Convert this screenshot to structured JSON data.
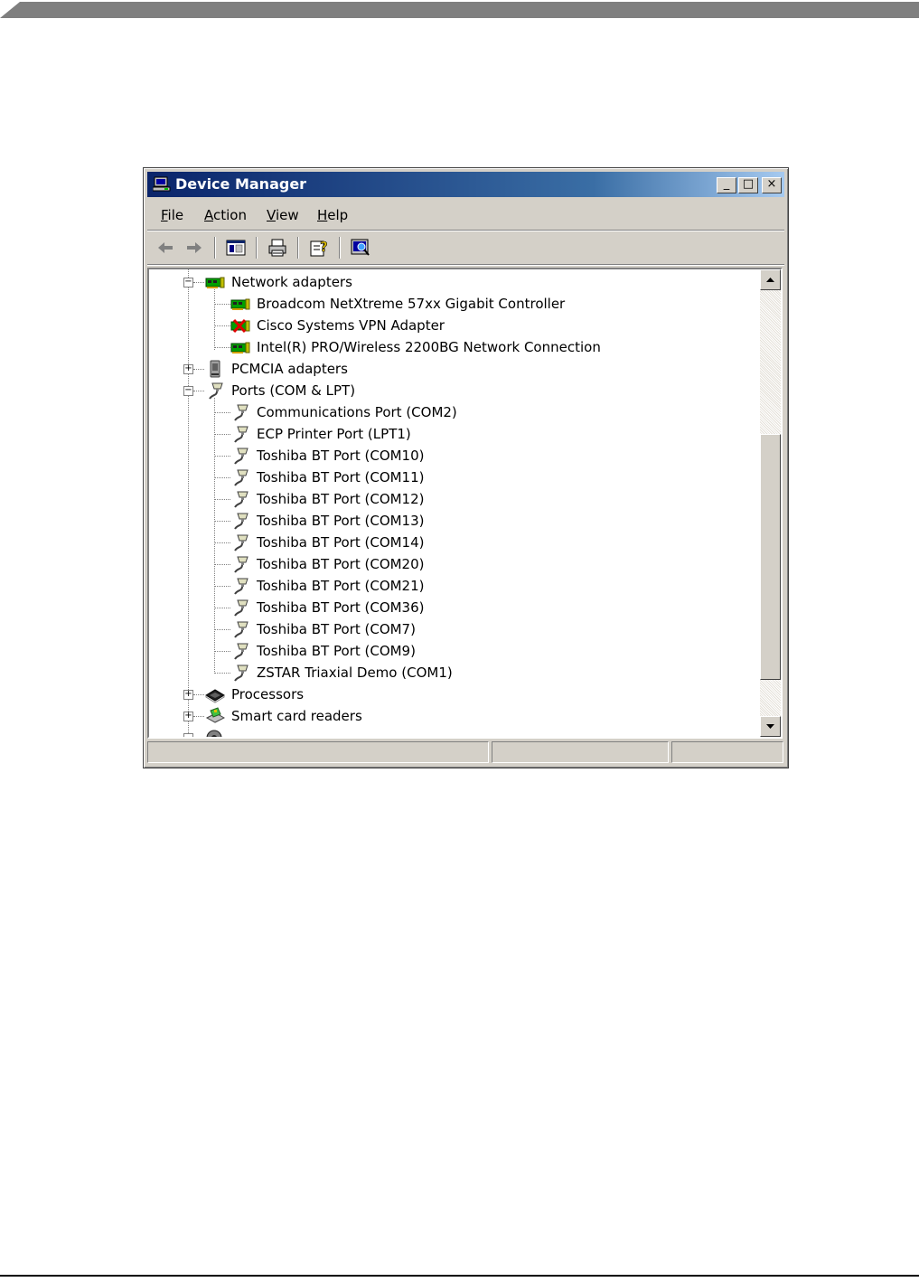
{
  "window": {
    "title": "Device Manager",
    "controls": {
      "minimize": "_",
      "maximize": "□",
      "close": "×"
    }
  },
  "menu": [
    {
      "accel": "F",
      "rest": "ile"
    },
    {
      "accel": "A",
      "rest": "ction"
    },
    {
      "accel": "V",
      "rest": "iew"
    },
    {
      "accel": "H",
      "rest": "elp"
    }
  ],
  "toolbar_icons": [
    "back-arrow-icon",
    "forward-arrow-icon",
    "show-hide-console-tree-icon",
    "print-icon",
    "help-properties-icon",
    "scan-hardware-icon"
  ],
  "tree": {
    "network_adapters": {
      "label": "Network adapters",
      "expander": "−",
      "children": [
        "Broadcom NetXtreme 57xx Gigabit Controller",
        "Cisco Systems VPN Adapter",
        "Intel(R) PRO/Wireless 2200BG Network Connection"
      ]
    },
    "pcmcia": {
      "label": "PCMCIA adapters",
      "expander": "+"
    },
    "ports": {
      "label": "Ports (COM & LPT)",
      "expander": "−",
      "children": [
        "Communications Port (COM2)",
        "ECP Printer Port (LPT1)",
        "Toshiba BT Port (COM10)",
        "Toshiba BT Port (COM11)",
        "Toshiba BT Port (COM12)",
        "Toshiba BT Port (COM13)",
        "Toshiba BT Port (COM14)",
        "Toshiba BT Port (COM20)",
        "Toshiba BT Port (COM21)",
        "Toshiba BT Port (COM36)",
        "Toshiba BT Port (COM7)",
        "Toshiba BT Port (COM9)",
        "ZSTAR Triaxial Demo (COM1)"
      ]
    },
    "processors": {
      "label": "Processors",
      "expander": "+"
    },
    "smart_card_readers": {
      "label": "Smart card readers",
      "expander": "+"
    }
  },
  "colors": {
    "title_start": "#0a246a",
    "title_end": "#a6caf0",
    "face": "#d4d0c8"
  }
}
